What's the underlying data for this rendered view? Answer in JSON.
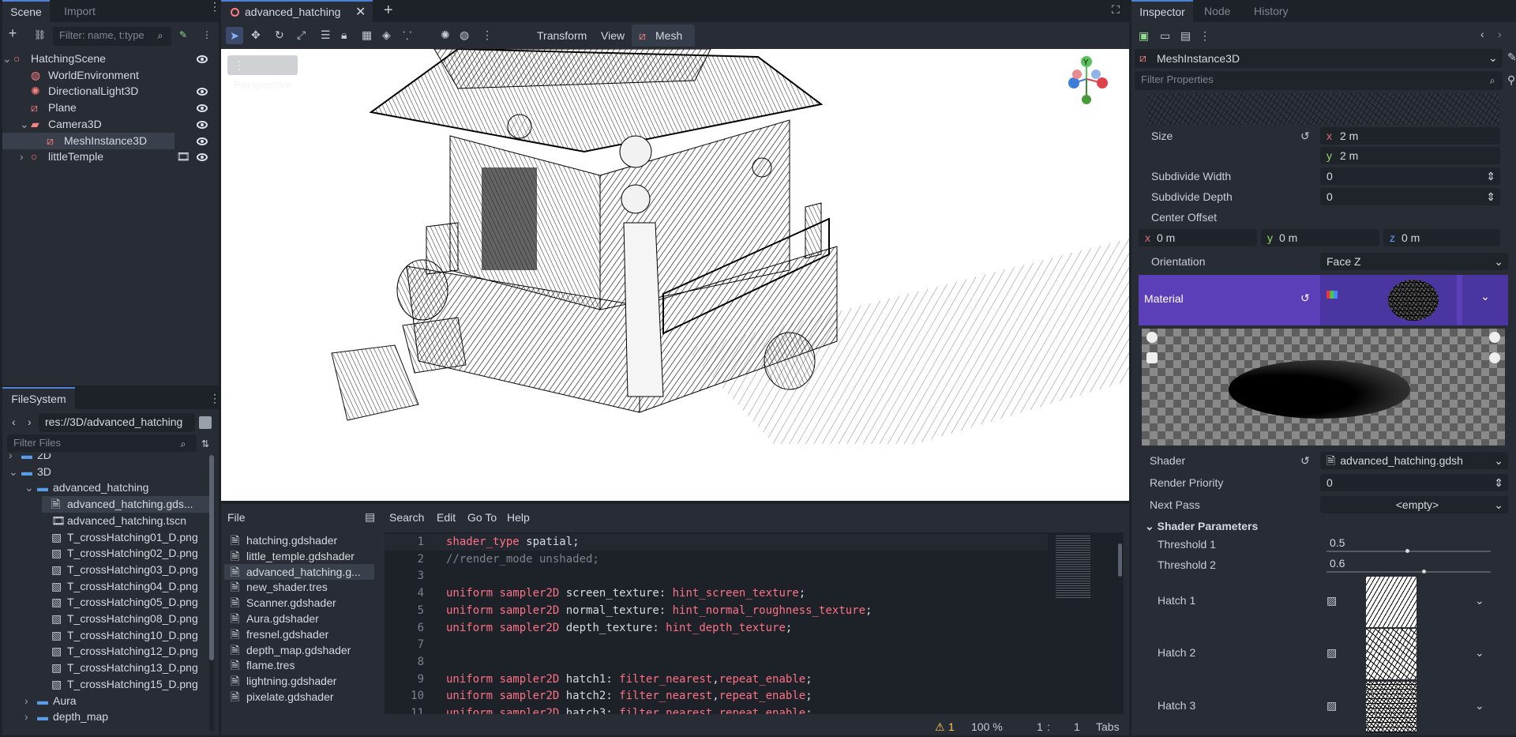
{
  "scene_panel": {
    "tabs": [
      "Scene",
      "Import"
    ],
    "filter_placeholder": "Filter: name, t:type",
    "tree": [
      {
        "label": "HatchingScene",
        "icon": "node3d-icon",
        "color": "#fc7f7f"
      },
      {
        "label": "WorldEnvironment",
        "icon": "world-environment-icon",
        "color": "#fc7f7f"
      },
      {
        "label": "DirectionalLight3D",
        "icon": "light-icon",
        "color": "#fc7f7f"
      },
      {
        "label": "Plane",
        "icon": "mesh-icon",
        "color": "#fc7f7f"
      },
      {
        "label": "Camera3D",
        "icon": "camera-icon",
        "color": "#fc7f7f"
      },
      {
        "label": "MeshInstance3D",
        "icon": "mesh-icon",
        "color": "#fc7f7f"
      },
      {
        "label": "littleTemple",
        "icon": "node3d-icon",
        "color": "#fc7f7f"
      }
    ]
  },
  "filesystem": {
    "title": "FileSystem",
    "path": "res://3D/advanced_hatching",
    "filter_placeholder": "Filter Files",
    "items": [
      {
        "label": "2D",
        "type": "folder"
      },
      {
        "label": "3D",
        "type": "folder"
      },
      {
        "label": "advanced_hatching",
        "type": "folder"
      },
      {
        "label": "advanced_hatching.gds...",
        "type": "file"
      },
      {
        "label": "advanced_hatching.tscn",
        "type": "scene"
      },
      {
        "label": "T_crossHatching01_D.png",
        "type": "image"
      },
      {
        "label": "T_crossHatching02_D.png",
        "type": "image"
      },
      {
        "label": "T_crossHatching03_D.png",
        "type": "image"
      },
      {
        "label": "T_crossHatching04_D.png",
        "type": "image"
      },
      {
        "label": "T_crossHatching05_D.png",
        "type": "image"
      },
      {
        "label": "T_crossHatching08_D.png",
        "type": "image"
      },
      {
        "label": "T_crossHatching10_D.png",
        "type": "image"
      },
      {
        "label": "T_crossHatching12_D.png",
        "type": "image"
      },
      {
        "label": "T_crossHatching13_D.png",
        "type": "image"
      },
      {
        "label": "T_crossHatching15_D.png",
        "type": "image"
      },
      {
        "label": "Aura",
        "type": "folder"
      },
      {
        "label": "depth_map",
        "type": "folder"
      }
    ]
  },
  "editor_tab": {
    "label": "advanced_hatching"
  },
  "toolbar": {
    "transform": "Transform",
    "view": "View",
    "mesh": "Mesh"
  },
  "viewport": {
    "perspective": "Perspective",
    "gizmo_y": "Y"
  },
  "script_editor": {
    "menus": [
      "File",
      "Search",
      "Edit",
      "Go To",
      "Help"
    ],
    "files": [
      "hatching.gdshader",
      "little_temple.gdshader",
      "advanced_hatching.g...",
      "new_shader.tres",
      "Scanner.gdshader",
      "Aura.gdshader",
      "fresnel.gdshader",
      "depth_map.gdshader",
      "flame.tres",
      "lightning.gdshader",
      "pixelate.gdshader"
    ],
    "lines": [
      {
        "n": "1",
        "parts": [
          [
            "kw",
            "shader_type"
          ],
          [
            "tx",
            " spatial;"
          ]
        ]
      },
      {
        "n": "2",
        "parts": [
          [
            "cm",
            "//render_mode unshaded;"
          ]
        ]
      },
      {
        "n": "3",
        "parts": []
      },
      {
        "n": "4",
        "parts": [
          [
            "kw",
            "uniform"
          ],
          [
            "tx",
            " "
          ],
          [
            "kw",
            "sampler2D"
          ],
          [
            "tx",
            " screen_texture: "
          ],
          [
            "kw",
            "hint_screen_texture"
          ],
          [
            "tx",
            ";"
          ]
        ]
      },
      {
        "n": "5",
        "parts": [
          [
            "kw",
            "uniform"
          ],
          [
            "tx",
            " "
          ],
          [
            "kw",
            "sampler2D"
          ],
          [
            "tx",
            " normal_texture: "
          ],
          [
            "kw",
            "hint_normal_roughness_texture"
          ],
          [
            "tx",
            ";"
          ]
        ]
      },
      {
        "n": "6",
        "parts": [
          [
            "kw",
            "uniform"
          ],
          [
            "tx",
            " "
          ],
          [
            "kw",
            "sampler2D"
          ],
          [
            "tx",
            " depth_texture: "
          ],
          [
            "kw",
            "hint_depth_texture"
          ],
          [
            "tx",
            ";"
          ]
        ]
      },
      {
        "n": "7",
        "parts": []
      },
      {
        "n": "8",
        "parts": []
      },
      {
        "n": "9",
        "parts": [
          [
            "kw",
            "uniform"
          ],
          [
            "tx",
            " "
          ],
          [
            "kw",
            "sampler2D"
          ],
          [
            "tx",
            " hatch1: "
          ],
          [
            "kw",
            "filter_nearest"
          ],
          [
            "tx",
            ","
          ],
          [
            "kw",
            "repeat_enable"
          ],
          [
            "tx",
            ";"
          ]
        ]
      },
      {
        "n": "10",
        "parts": [
          [
            "kw",
            "uniform"
          ],
          [
            "tx",
            " "
          ],
          [
            "kw",
            "sampler2D"
          ],
          [
            "tx",
            " hatch2: "
          ],
          [
            "kw",
            "filter_nearest"
          ],
          [
            "tx",
            ","
          ],
          [
            "kw",
            "repeat_enable"
          ],
          [
            "tx",
            ";"
          ]
        ]
      },
      {
        "n": "11",
        "parts": [
          [
            "kw",
            "uniform"
          ],
          [
            "tx",
            " "
          ],
          [
            "kw",
            "sampler2D"
          ],
          [
            "tx",
            " hatch3: "
          ],
          [
            "kw",
            "filter_nearest"
          ],
          [
            "tx",
            ","
          ],
          [
            "kw",
            "repeat_enable"
          ],
          [
            "tx",
            ";"
          ]
        ]
      }
    ],
    "status": {
      "warnings": "1",
      "zoom": "100 %",
      "line": "1",
      "col": "1",
      "indent": "Tabs"
    }
  },
  "inspector": {
    "tabs": [
      "Inspector",
      "Node",
      "History"
    ],
    "node": "MeshInstance3D",
    "filter_placeholder": "Filter Properties",
    "size_label": "Size",
    "size_x": "2 m",
    "size_y": "2 m",
    "subdivide_width_label": "Subdivide Width",
    "subdivide_width": "0",
    "subdivide_depth_label": "Subdivide Depth",
    "subdivide_depth": "0",
    "center_offset_label": "Center Offset",
    "center_x": "0 m",
    "center_y": "0 m",
    "center_z": "0 m",
    "orientation_label": "Orientation",
    "orientation": "Face Z",
    "material_label": "Material",
    "shader_label": "Shader",
    "shader_value": "advanced_hatching.gdsh",
    "render_priority_label": "Render Priority",
    "render_priority": "0",
    "next_pass_label": "Next Pass",
    "next_pass": "<empty>",
    "shader_params_label": "Shader Parameters",
    "threshold1_label": "Threshold 1",
    "threshold1": "0.5",
    "threshold2_label": "Threshold 2",
    "threshold2": "0.6",
    "hatch1_label": "Hatch 1",
    "hatch2_label": "Hatch 2",
    "hatch3_label": "Hatch 3",
    "axis_x": "x",
    "axis_y": "y",
    "axis_z": "z"
  },
  "colors": {
    "accent": "#4f80d8",
    "material_bg": "#5a3fb8",
    "keyword": "#ff7085"
  }
}
